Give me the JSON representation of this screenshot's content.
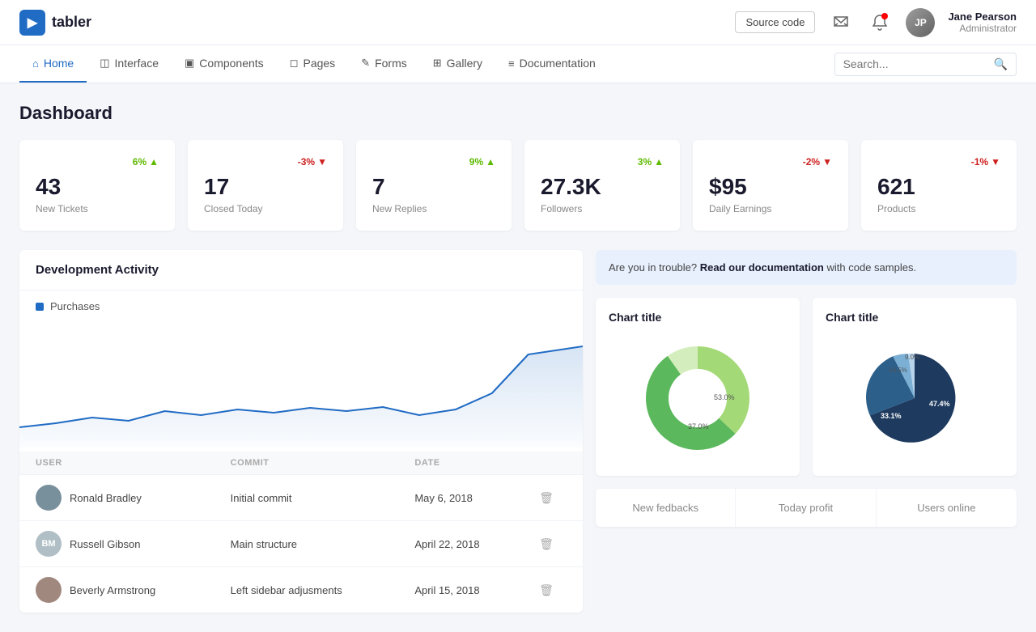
{
  "app": {
    "logo_text": "tabler",
    "logo_char": "▶"
  },
  "header": {
    "source_code_label": "Source code",
    "user_name": "Jane Pearson",
    "user_role": "Administrator"
  },
  "nav": {
    "items": [
      {
        "label": "Home",
        "icon": "⌂",
        "active": true
      },
      {
        "label": "Interface",
        "icon": "◫"
      },
      {
        "label": "Components",
        "icon": "▣"
      },
      {
        "label": "Pages",
        "icon": "◻"
      },
      {
        "label": "Forms",
        "icon": "✎"
      },
      {
        "label": "Gallery",
        "icon": "⊞"
      },
      {
        "label": "Documentation",
        "icon": "≡"
      }
    ],
    "search_placeholder": "Search..."
  },
  "page": {
    "title": "Dashboard"
  },
  "stats": [
    {
      "value": "43",
      "label": "New Tickets",
      "change": "6%",
      "direction": "up"
    },
    {
      "value": "17",
      "label": "Closed Today",
      "change": "-3%",
      "direction": "down"
    },
    {
      "value": "7",
      "label": "New Replies",
      "change": "9%",
      "direction": "up"
    },
    {
      "value": "27.3K",
      "label": "Followers",
      "change": "3%",
      "direction": "up"
    },
    {
      "value": "$95",
      "label": "Daily Earnings",
      "change": "-2%",
      "direction": "down"
    },
    {
      "value": "621",
      "label": "Products",
      "change": "-1%",
      "direction": "down"
    }
  ],
  "dev_activity": {
    "title": "Development Activity",
    "legend": "Purchases"
  },
  "table": {
    "columns": [
      "USER",
      "COMMIT",
      "DATE"
    ],
    "rows": [
      {
        "user": "Ronald Bradley",
        "initials": "",
        "has_photo": true,
        "photo_color": "#607d8b",
        "commit": "Initial commit",
        "date": "May 6, 2018"
      },
      {
        "user": "Russell Gibson",
        "initials": "BM",
        "has_photo": false,
        "photo_color": "#9e9e9e",
        "commit": "Main structure",
        "date": "April 22, 2018"
      },
      {
        "user": "Beverly Armstrong",
        "initials": "",
        "has_photo": true,
        "photo_color": "#a1887f",
        "commit": "Left sidebar adjusments",
        "date": "April 15, 2018"
      }
    ]
  },
  "alert": {
    "text_before": "Are you in trouble?",
    "link_text": "Read our documentation",
    "text_after": "with code samples."
  },
  "chart1": {
    "title": "Chart title",
    "segments": [
      {
        "label": "37.0%",
        "value": 37,
        "color": "#a3d977"
      },
      {
        "label": "53.0%",
        "value": 53,
        "color": "#5cb85c"
      },
      {
        "label": "10.0%",
        "value": 10,
        "color": "#d4edbc"
      }
    ]
  },
  "chart2": {
    "title": "Chart title",
    "segments": [
      {
        "label": "47.4%",
        "value": 47.4,
        "color": "#1e3a5f"
      },
      {
        "label": "33.1%",
        "value": 33.1,
        "color": "#2c5f8a"
      },
      {
        "label": "10.5%",
        "value": 10.5,
        "color": "#7bafd4"
      },
      {
        "label": "9.0%",
        "value": 9.0,
        "color": "#b8d4ea"
      }
    ]
  },
  "bottom_cards": [
    {
      "label": "New fedbacks"
    },
    {
      "label": "Today profit"
    },
    {
      "label": "Users online"
    }
  ]
}
